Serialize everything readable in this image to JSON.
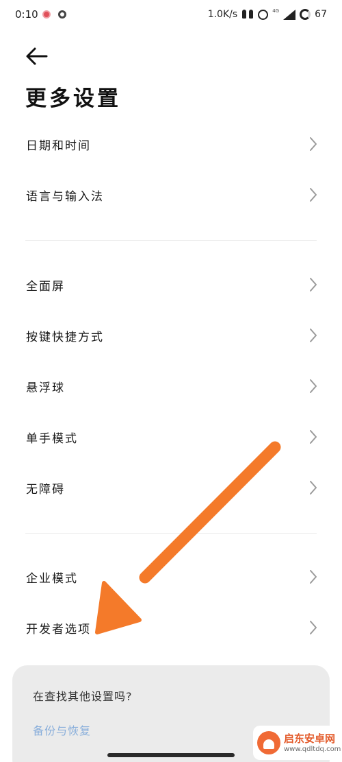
{
  "status_bar": {
    "time": "0:10",
    "speed": "1.0K/s",
    "network_label": "4G",
    "battery": "67",
    "icons": [
      "notification-red-dot-icon",
      "notification-ring-icon",
      "earbuds-icon",
      "alarm-icon",
      "signal-icon",
      "battery-icon"
    ]
  },
  "header": {
    "back_icon": "back-arrow-icon",
    "title": "更多设置"
  },
  "groups": [
    {
      "items": [
        {
          "label": "日期和时间"
        },
        {
          "label": "语言与输入法"
        }
      ]
    },
    {
      "items": [
        {
          "label": "全面屏"
        },
        {
          "label": "按键快捷方式"
        },
        {
          "label": "悬浮球"
        },
        {
          "label": "单手模式"
        },
        {
          "label": "无障碍"
        }
      ]
    },
    {
      "items": [
        {
          "label": "企业模式"
        },
        {
          "label": "开发者选项"
        }
      ]
    }
  ],
  "suggestion_card": {
    "title": "在查找其他设置吗?",
    "link": "备份与恢复"
  },
  "annotation": {
    "icon": "orange-arrow-annotation",
    "color": "#f47a2a",
    "points_to": "开发者选项"
  },
  "watermark": {
    "name": "启东安卓网",
    "url": "www.qdltdq.com",
    "color": "#e35a2a"
  },
  "colors": {
    "background": "#ffffff",
    "text": "#1a1a1a",
    "chevron": "#9a9a9a",
    "card_bg": "#ebebeb",
    "link": "#88aedb"
  }
}
